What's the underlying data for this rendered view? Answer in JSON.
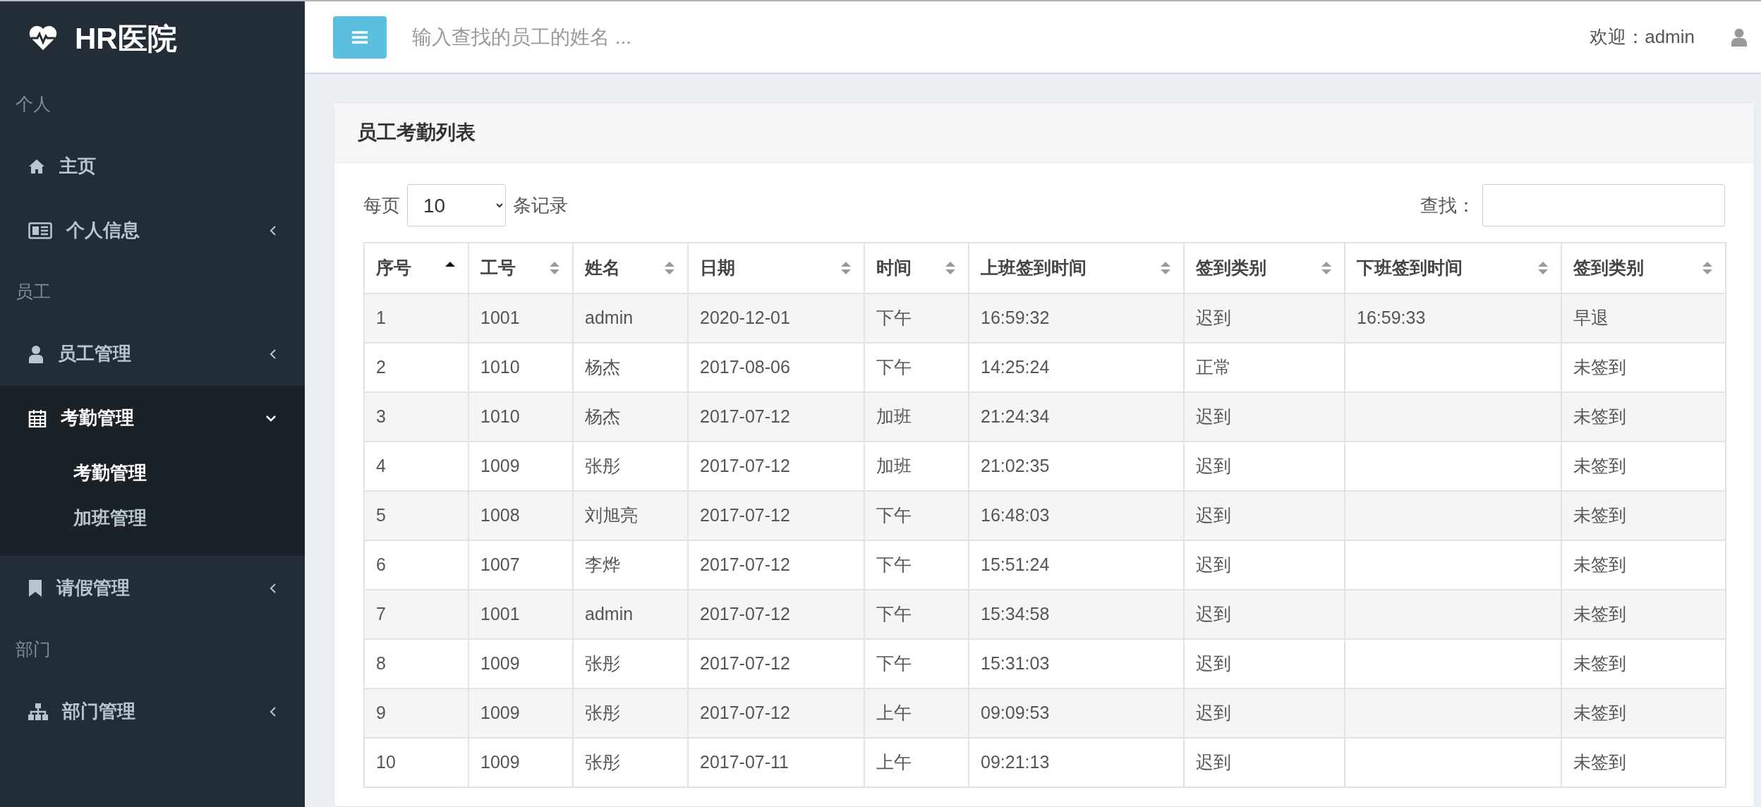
{
  "sidebar": {
    "logo": "HR医院",
    "sections": [
      {
        "heading": "个人",
        "items": [
          {
            "label": "主页",
            "kind": "link"
          },
          {
            "label": "个人信息",
            "kind": "menu",
            "expanded": false
          }
        ]
      },
      {
        "heading": "员工",
        "items": [
          {
            "label": "员工管理",
            "kind": "menu",
            "expanded": false
          },
          {
            "label": "考勤管理",
            "kind": "menu",
            "expanded": true,
            "children": [
              {
                "label": "考勤管理",
                "selected": true
              },
              {
                "label": "加班管理",
                "selected": false
              }
            ]
          },
          {
            "label": "请假管理",
            "kind": "menu",
            "expanded": false
          }
        ]
      },
      {
        "heading": "部门",
        "items": [
          {
            "label": "部门管理",
            "kind": "menu",
            "expanded": false
          }
        ]
      }
    ]
  },
  "topbar": {
    "search": {
      "placeholder": "输入查找的员工的姓名 ..."
    },
    "welcome": "欢迎：admin"
  },
  "card": {
    "title": "员工考勤列表",
    "page_size_before": "每页",
    "page_size": "10",
    "page_size_after": "条记录",
    "search_label": "查找：",
    "table": {
      "columns": [
        {
          "label": "序号",
          "sorted": true
        },
        {
          "label": "工号",
          "sorted": false
        },
        {
          "label": "姓名",
          "sorted": false
        },
        {
          "label": "日期",
          "sorted": false
        },
        {
          "label": "时间",
          "sorted": false
        },
        {
          "label": "上班签到时间",
          "sorted": false
        },
        {
          "label": "签到类别",
          "sorted": false
        },
        {
          "label": "下班签到时间",
          "sorted": false
        },
        {
          "label": "签到类别",
          "sorted": false
        }
      ],
      "rows": [
        [
          "1",
          "1001",
          "admin",
          "2020-12-01",
          "下午",
          "16:59:32",
          "迟到",
          "16:59:33",
          "早退"
        ],
        [
          "2",
          "1010",
          "杨杰",
          "2017-08-06",
          "下午",
          "14:25:24",
          "正常",
          "",
          "未签到"
        ],
        [
          "3",
          "1010",
          "杨杰",
          "2017-07-12",
          "加班",
          "21:24:34",
          "迟到",
          "",
          "未签到"
        ],
        [
          "4",
          "1009",
          "张彤",
          "2017-07-12",
          "加班",
          "21:02:35",
          "迟到",
          "",
          "未签到"
        ],
        [
          "5",
          "1008",
          "刘旭亮",
          "2017-07-12",
          "下午",
          "16:48:03",
          "迟到",
          "",
          "未签到"
        ],
        [
          "6",
          "1007",
          "李烨",
          "2017-07-12",
          "下午",
          "15:51:24",
          "迟到",
          "",
          "未签到"
        ],
        [
          "7",
          "1001",
          "admin",
          "2017-07-12",
          "下午",
          "15:34:58",
          "迟到",
          "",
          "未签到"
        ],
        [
          "8",
          "1009",
          "张彤",
          "2017-07-12",
          "下午",
          "15:31:03",
          "迟到",
          "",
          "未签到"
        ],
        [
          "9",
          "1009",
          "张彤",
          "2017-07-12",
          "上午",
          "09:09:53",
          "迟到",
          "",
          "未签到"
        ],
        [
          "10",
          "1009",
          "张彤",
          "2017-07-11",
          "上午",
          "09:21:13",
          "迟到",
          "",
          "未签到"
        ]
      ]
    }
  }
}
